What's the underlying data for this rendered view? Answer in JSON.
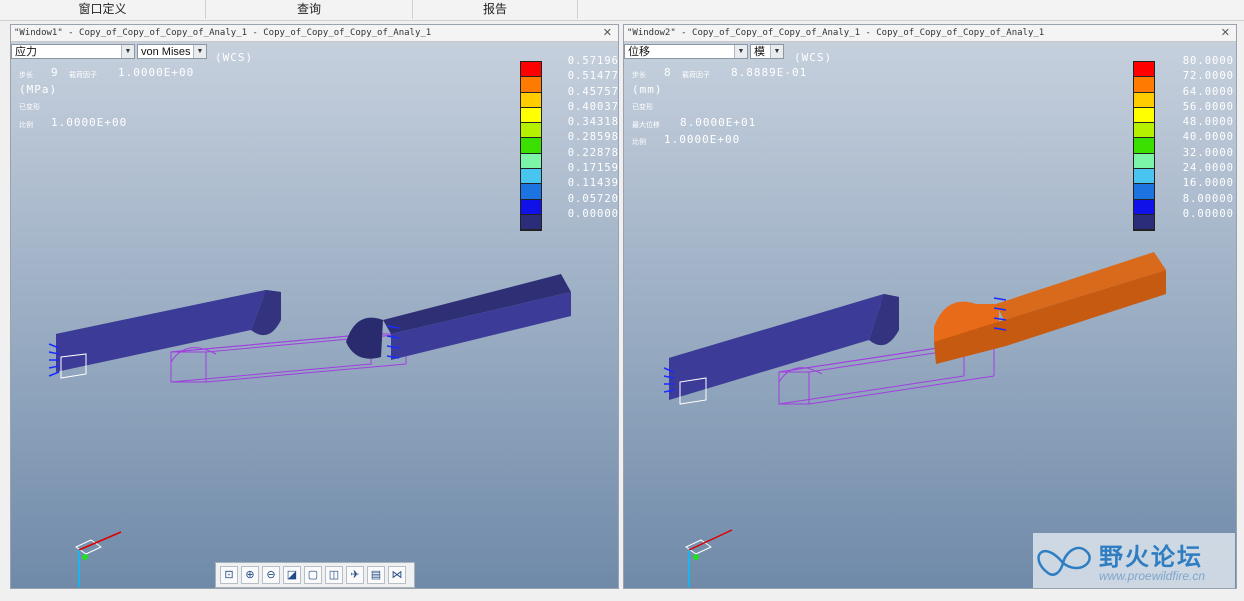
{
  "menu": {
    "items": [
      "窗口定义",
      "查询",
      "报告"
    ]
  },
  "window1": {
    "title": "\"Window1\" - Copy_of_Copy_of_Copy_of_Analy_1 - Copy_of_Copy_of_Copy_of_Analy_1",
    "close_icon": "✕",
    "quantity_combo": "应力",
    "component_combo": "von Mises",
    "wcs": "(WCS)",
    "step_label": "步长",
    "step_value": "9",
    "factor_label": "载荷因子",
    "factor_value": "1.0000E+00",
    "units": "(MPa)",
    "deformed_label": "已变形",
    "scale_label": "比例",
    "scale_value": "1.0000E+00",
    "legend_values": [
      "0.57196",
      "0.51477",
      "0.45757",
      "0.40037",
      "0.34318",
      "0.28598",
      "0.22878",
      "0.17159",
      "0.11439",
      "0.05720",
      "0.00000"
    ]
  },
  "window2": {
    "title": "\"Window2\" - Copy_of_Copy_of_Copy_of_Analy_1 - Copy_of_Copy_of_Copy_of_Analy_1",
    "close_icon": "✕",
    "quantity_combo": "位移",
    "component_combo": "模",
    "wcs": "(WCS)",
    "step_label": "步长",
    "step_value": "8",
    "factor_label": "载荷因子",
    "factor_value": "8.8889E-01",
    "units": "(mm)",
    "deformed_label": "已变形",
    "max_disp_label": "最大位移",
    "max_disp_value": "8.0000E+01",
    "scale_label": "比例",
    "scale_value": "1.0000E+00",
    "legend_values": [
      "80.0000",
      "72.0000",
      "64.0000",
      "56.0000",
      "48.0000",
      "40.0000",
      "32.0000",
      "24.0000",
      "16.0000",
      "8.00000",
      "0.00000"
    ]
  },
  "legend_colors": [
    "#ff0000",
    "#ff7a00",
    "#ffcc00",
    "#ffff00",
    "#b5f000",
    "#3ce000",
    "#7cf5a8",
    "#48c4f0",
    "#1d74e0",
    "#1010e8",
    "#2b2c7a"
  ],
  "toolbar": {
    "buttons": [
      "refit-icon",
      "zoom-in-icon",
      "zoom-out-icon",
      "repaint-icon",
      "saved-views-icon",
      "named-view-icon",
      "spin-center-icon",
      "display-style-icon",
      "animate-icon"
    ]
  },
  "watermark": {
    "title": "野火论坛",
    "url": "www.proewildfire.cn"
  }
}
